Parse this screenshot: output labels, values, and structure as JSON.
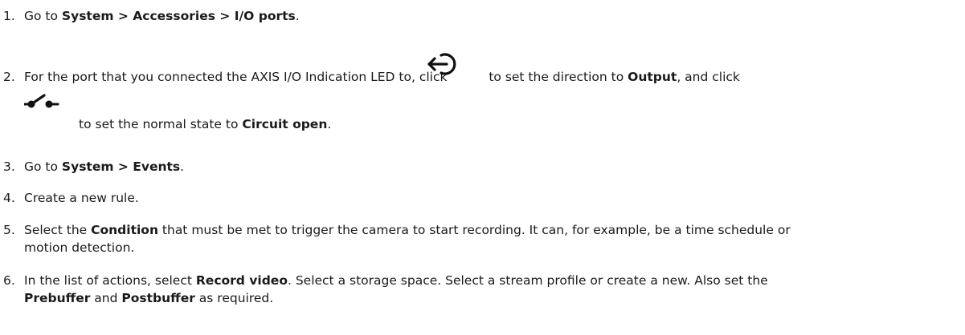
{
  "steps": [
    {
      "number": "1.",
      "segments": [
        {
          "text": "Go to ",
          "bold": false
        },
        {
          "text": "System > Accessories > I/O ports",
          "bold": true
        },
        {
          "text": ".",
          "bold": false
        }
      ]
    },
    {
      "number": "2.",
      "segments": [
        {
          "text": "For the port that you connected the AXIS I/O Indication LED to, click ",
          "bold": false
        },
        {
          "icon": "direction-toggle-icon"
        },
        {
          "text": " to set the direction to ",
          "bold": false
        },
        {
          "text": "Output",
          "bold": true
        },
        {
          "text": ", and click",
          "bold": false
        }
      ],
      "continuation": [
        {
          "icon": "normal-state-switch-icon"
        },
        {
          "text": "to set the normal state to ",
          "bold": false
        },
        {
          "text": "Circuit open",
          "bold": true
        },
        {
          "text": ".",
          "bold": false
        }
      ]
    },
    {
      "number": "3.",
      "segments": [
        {
          "text": "Go to ",
          "bold": false
        },
        {
          "text": "System > Events",
          "bold": true
        },
        {
          "text": ".",
          "bold": false
        }
      ]
    },
    {
      "number": "4.",
      "segments": [
        {
          "text": "Create a new rule.",
          "bold": false
        }
      ]
    },
    {
      "number": "5.",
      "lines": [
        [
          {
            "text": "Select the ",
            "bold": false
          },
          {
            "text": "Condition",
            "bold": true
          },
          {
            "text": " that must be met to trigger the camera to start recording. It can, for example, be a time schedule or",
            "bold": false
          }
        ],
        [
          {
            "text": "motion detection.",
            "bold": false
          }
        ]
      ]
    },
    {
      "number": "6.",
      "lines": [
        [
          {
            "text": "In the list of actions, select ",
            "bold": false
          },
          {
            "text": "Record video",
            "bold": true
          },
          {
            "text": ". Select a storage space. Select a stream profile or create a new. Also set the",
            "bold": false
          }
        ],
        [
          {
            "text": "Prebuffer",
            "bold": true
          },
          {
            "text": " and ",
            "bold": false
          },
          {
            "text": "Postbuffer",
            "bold": true
          },
          {
            "text": " as required.",
            "bold": false
          }
        ]
      ]
    }
  ]
}
